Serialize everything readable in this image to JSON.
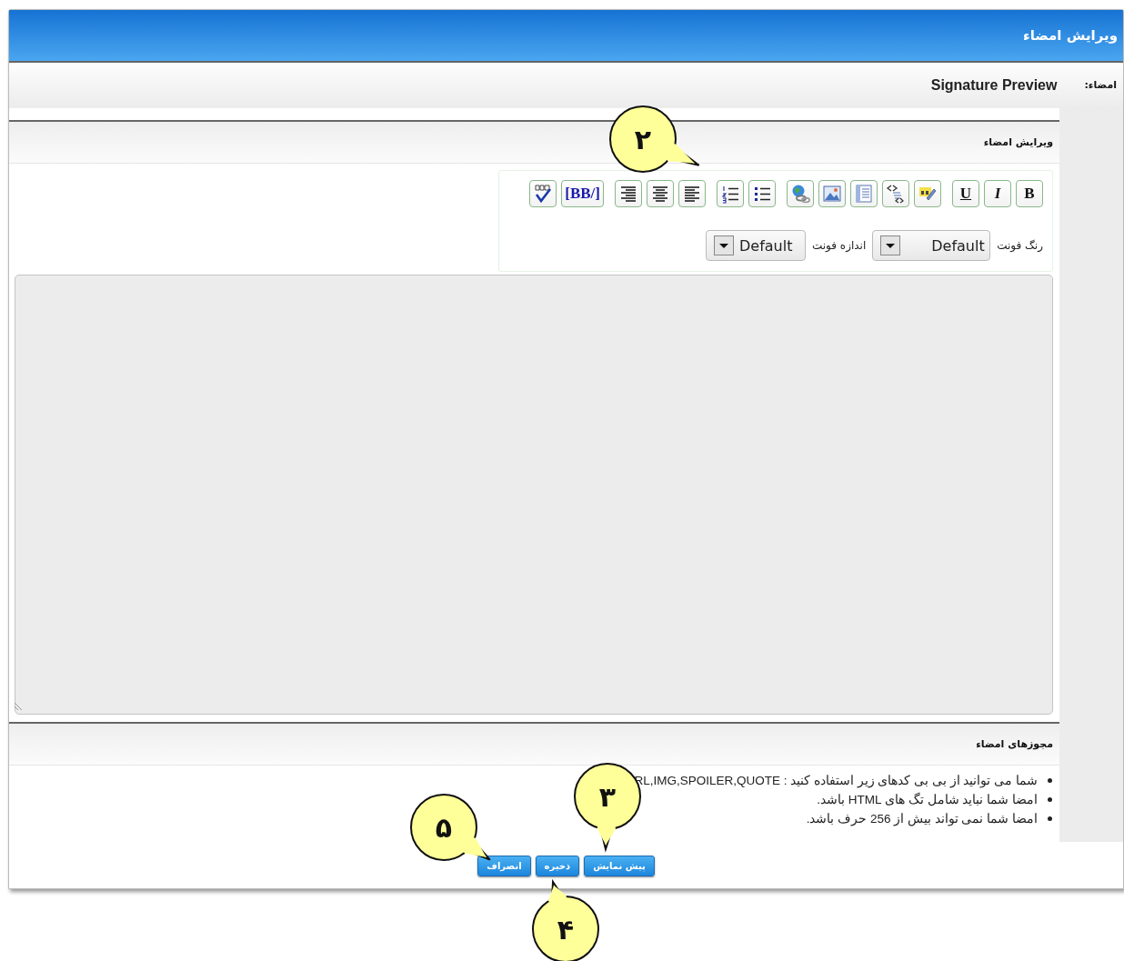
{
  "window": {
    "title": "ویرایش امضاء"
  },
  "signature": {
    "label": "امضاء:",
    "preview": "Signature Preview"
  },
  "editor": {
    "title": "ویرایش امضاء",
    "toolbar": [
      [
        {
          "kind": "bold",
          "label": "B"
        },
        {
          "kind": "italic",
          "label": "I"
        },
        {
          "kind": "underline",
          "label": "U"
        }
      ],
      [
        {
          "kind": "highlight"
        },
        {
          "kind": "code"
        },
        {
          "kind": "document"
        },
        {
          "kind": "image"
        },
        {
          "kind": "link"
        }
      ],
      [
        {
          "kind": "bullet-list"
        },
        {
          "kind": "numbered-list"
        }
      ],
      [
        {
          "kind": "align-left"
        },
        {
          "kind": "align-center"
        },
        {
          "kind": "align-right"
        }
      ],
      [
        {
          "kind": "bbcode",
          "label": "[BB/]"
        },
        {
          "kind": "spellcheck"
        }
      ]
    ],
    "font_color": {
      "label": "رنگ فونت",
      "value": "Default"
    },
    "font_size": {
      "label": "اندازه فونت",
      "value": "Default"
    }
  },
  "permissions": {
    "title": "مجوزهای امضاء",
    "items": [
      "شما می توانید از بی بی کدهای زیر استفاده کنید : RL,IMG,SPOILER,QUOTE",
      "امضا شما نباید شامل تگ های HTML باشد.",
      "امضا شما نمی تواند بیش از 256 حرف باشد."
    ]
  },
  "buttons": [
    "پیش نمایش",
    "ذخیره",
    "انصراف"
  ],
  "callouts": [
    "۲",
    "۳",
    "۴",
    "۵"
  ]
}
